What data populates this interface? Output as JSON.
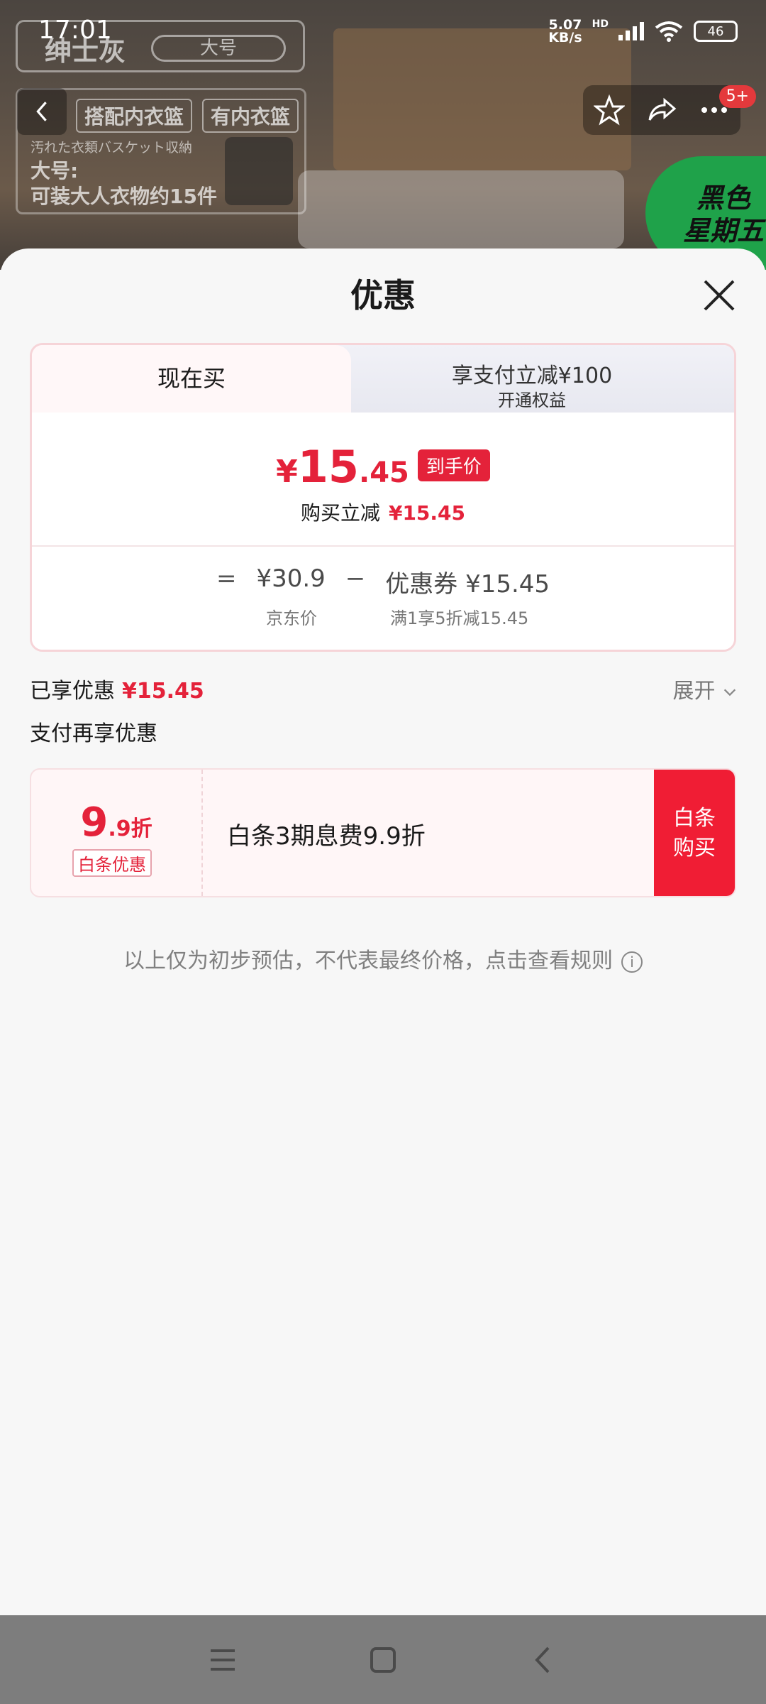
{
  "status": {
    "time": "17:01",
    "net_speed_top": "5.07",
    "net_speed_unit": "KB/s",
    "hd": "HD",
    "battery": "46"
  },
  "background": {
    "color_label": "绅士灰",
    "size_label": "大号",
    "pill1": "搭配内衣篮",
    "pill2": "有内衣篮",
    "jp_text": "汚れた衣類バスケット収納",
    "size_title": "大号:",
    "capacity": "可装大人衣物约15件",
    "badge": "5+",
    "promo_line1": "黑色",
    "promo_line2": "星期五"
  },
  "sheet": {
    "title": "优惠",
    "tabs": [
      {
        "label": "现在买"
      },
      {
        "label": "享支付立减¥100",
        "sub": "开通权益"
      }
    ],
    "price": {
      "currency": "¥",
      "int": "15",
      "dec": ".45",
      "tag": "到手价"
    },
    "reduction": {
      "label": "购买立减",
      "amount": "¥15.45"
    },
    "formula": {
      "eq": "=",
      "jd_price": "¥30.9",
      "minus": "−",
      "coupon": "优惠券 ¥15.45"
    },
    "formula_labels": {
      "jd_price_label": "京东价",
      "coupon_label": "满1享5折减15.45"
    },
    "enjoyed": {
      "label": "已享优惠",
      "amount": "¥15.45",
      "expand": "展开"
    },
    "pay_more": "支付再享优惠",
    "coupon": {
      "num": "9",
      "sub": ".9折",
      "tag": "白条优惠",
      "desc": "白条3期息费9.9折",
      "buy_line1": "白条",
      "buy_line2": "购买"
    },
    "rules": "以上仅为初步预估，不代表最终价格，点击查看规则",
    "info_icon": "i"
  },
  "colors": {
    "accent": "#e4223a",
    "buy_button": "#f01d34"
  }
}
